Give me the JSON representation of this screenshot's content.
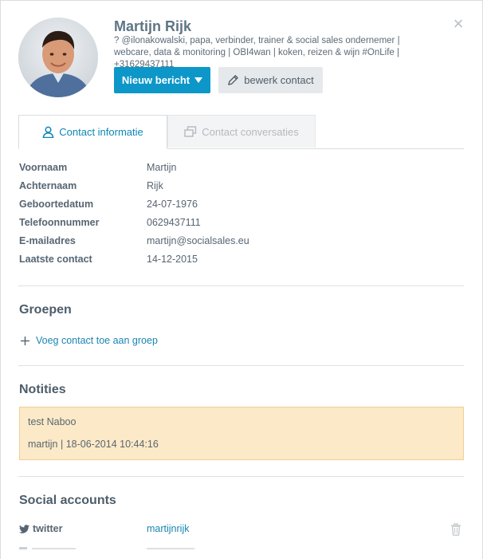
{
  "contact": {
    "name": "Martijn Rijk",
    "bio": "? @ilonakowalski, papa, verbinder, trainer & social sales ondernemer | webcare, data & monitoring | OBI4wan | koken, reizen & wijn #OnLife | +31629437111"
  },
  "actions": {
    "new_message_label": "Nieuw bericht",
    "edit_contact_label": "bewerk contact",
    "close_icon": "close-icon"
  },
  "tabs": [
    {
      "label": "Contact informatie",
      "icon": "user-icon",
      "active": true
    },
    {
      "label": "Contact conversaties",
      "icon": "conversations-icon",
      "active": false
    }
  ],
  "info": [
    {
      "label": "Voornaam",
      "value": "Martijn"
    },
    {
      "label": "Achternaam",
      "value": "Rijk"
    },
    {
      "label": "Geboortedatum",
      "value": "24-07-1976"
    },
    {
      "label": "Telefoonnummer",
      "value": "0629437111"
    },
    {
      "label": "E-mailadres",
      "value": "martijn@socialsales.eu"
    },
    {
      "label": "Laatste contact",
      "value": "14-12-2015"
    }
  ],
  "groups": {
    "title": "Groepen",
    "add_label": "Voeg contact toe aan groep"
  },
  "notes": {
    "title": "Notities",
    "items": [
      {
        "text": "test Naboo",
        "meta": "martijn | 18-06-2014 10:44:16"
      }
    ]
  },
  "social": {
    "title": "Social accounts",
    "accounts": [
      {
        "network": "twitter",
        "icon": "twitter-icon",
        "handle": "martijnrijk"
      }
    ]
  },
  "colors": {
    "accent": "#0d97c9",
    "link": "#1a85b3",
    "note_bg": "#fce9c8",
    "note_border": "#f0cf93"
  }
}
